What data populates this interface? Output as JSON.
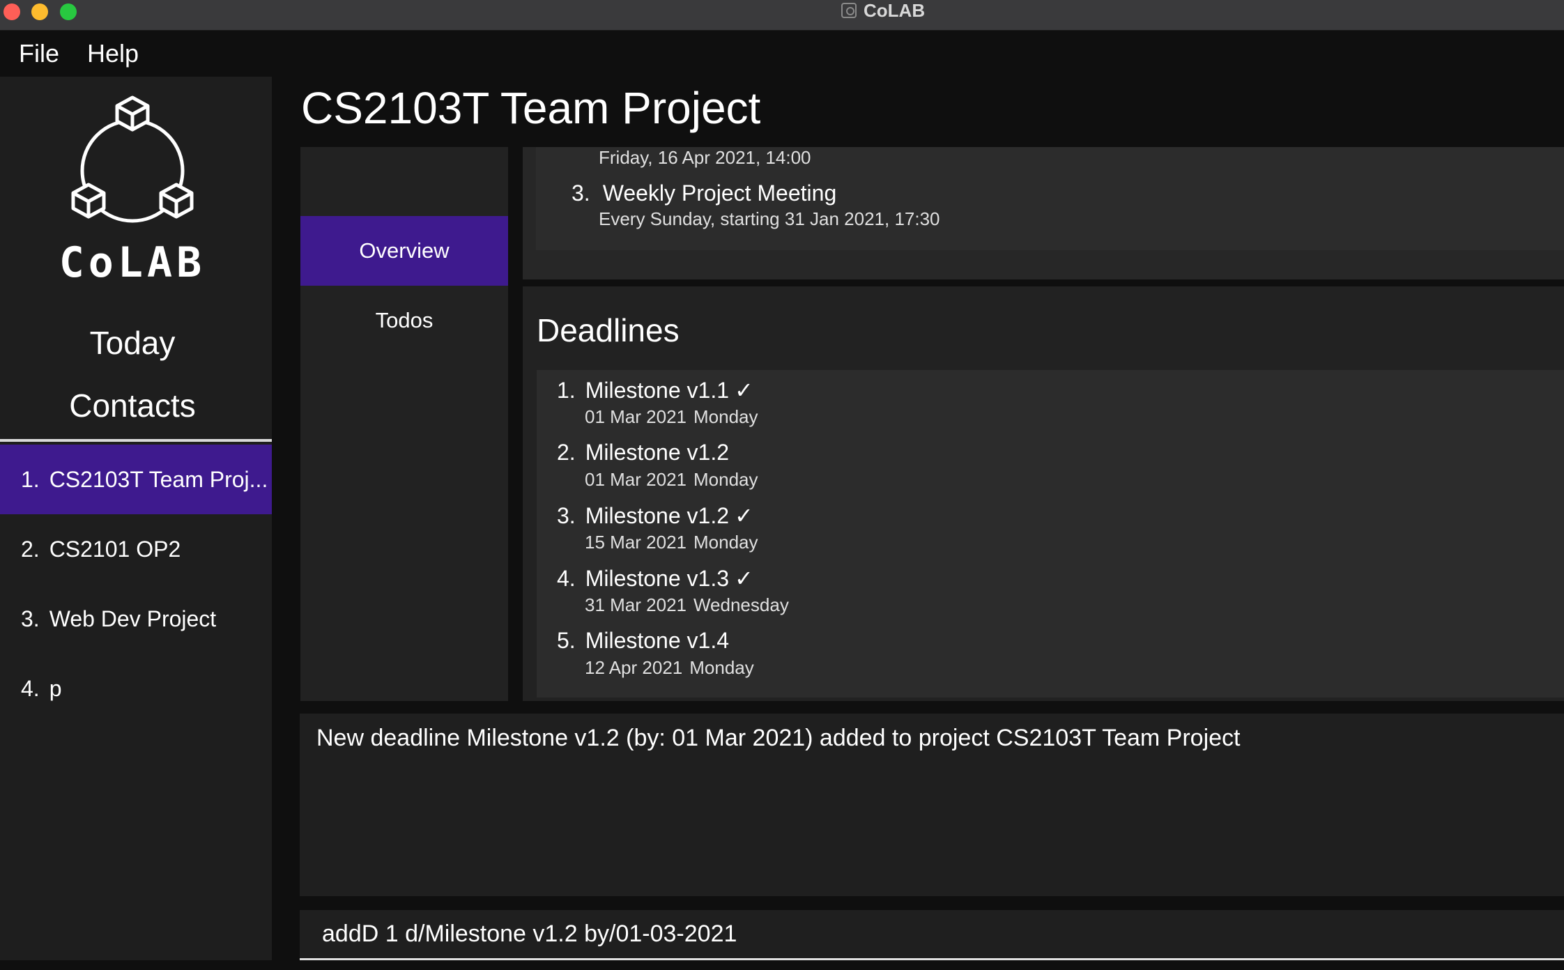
{
  "window": {
    "title": "CoLAB"
  },
  "menu": {
    "items": [
      "File",
      "Help"
    ]
  },
  "sidebar": {
    "logo_text": "CoLAB",
    "links": [
      "Today",
      "Contacts"
    ],
    "projects": [
      {
        "num": "1.",
        "label": "CS2103T Team Proj...",
        "active": true
      },
      {
        "num": "2.",
        "label": "CS2101 OP2",
        "active": false
      },
      {
        "num": "3.",
        "label": "Web Dev Project",
        "active": false
      },
      {
        "num": "4.",
        "label": "p",
        "active": false
      }
    ]
  },
  "main": {
    "project_title": "CS2103T Team Project",
    "tabs": [
      "Overview",
      "Todos"
    ],
    "active_tab": "Overview",
    "events": {
      "partial_date": "Friday, 16 Apr 2021, 14:00",
      "item3": {
        "num": "3.",
        "title": "Weekly Project Meeting",
        "subtitle": "Every Sunday, starting 31 Jan 2021, 17:30"
      }
    },
    "deadlines": {
      "heading": "Deadlines",
      "items": [
        {
          "num": "1.",
          "title": "Milestone v1.1",
          "check": "✓",
          "date": "01 Mar 2021",
          "day": "Monday"
        },
        {
          "num": "2.",
          "title": "Milestone v1.2",
          "check": "",
          "date": "01 Mar 2021",
          "day": "Monday"
        },
        {
          "num": "3.",
          "title": "Milestone v1.2",
          "check": "✓",
          "date": "15 Mar 2021",
          "day": "Monday"
        },
        {
          "num": "4.",
          "title": "Milestone v1.3",
          "check": "✓",
          "date": "31 Mar 2021",
          "day": "Wednesday"
        },
        {
          "num": "5.",
          "title": "Milestone v1.4",
          "check": "",
          "date": "12 Apr 2021",
          "day": "Monday"
        }
      ]
    },
    "result": "New deadline Milestone v1.2 (by: 01 Mar 2021) added to project CS2103T Team Project",
    "command": "addD 1 d/Milestone v1.2 by/01-03-2021"
  },
  "colors": {
    "accent": "#3e1a8e",
    "background": "#0f0f0f",
    "sidebar": "#1e1e1e",
    "panel": "#2c2c2c"
  }
}
